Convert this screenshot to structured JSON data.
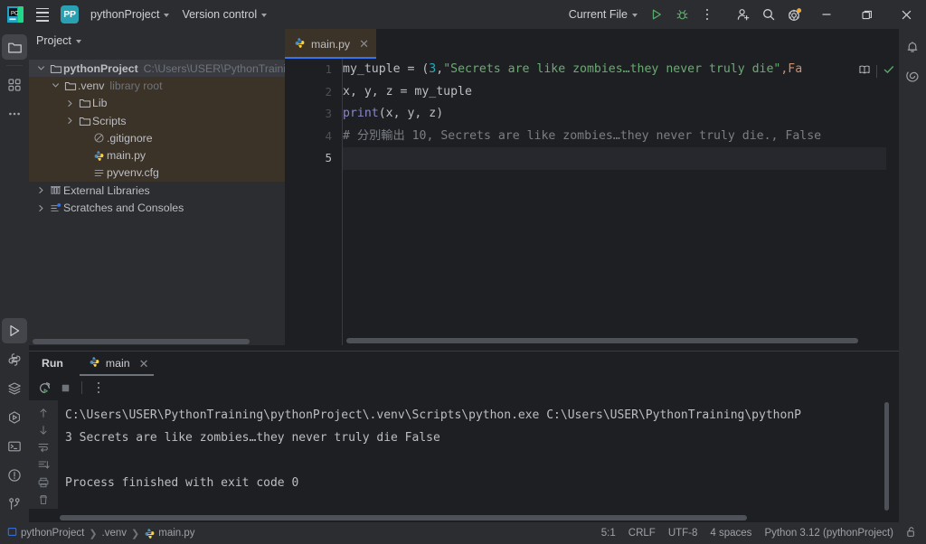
{
  "titlebar": {
    "ide_icon": "pycharm-logo-icon",
    "menu_icon": "main-menu-hamburger-icon",
    "project_badge": "PP",
    "project_name": "pythonProject",
    "version_control": "Version control",
    "run_config": "Current File",
    "run_icon": "run-triangle-icon",
    "debug_icon": "debug-bug-icon",
    "more_icon": "more-vertical-icon",
    "account_icon": "add-user-icon",
    "search_icon": "search-magnifier-icon",
    "settings_icon": "gear-icon",
    "minimize_icon": "window-minimize-icon",
    "maximize_icon": "window-maximize-icon",
    "close_icon": "window-close-icon"
  },
  "left_activity_bar": {
    "items": [
      {
        "name": "project-tool-button",
        "icon": "folder-icon",
        "selected": true
      },
      {
        "name": "structure-tool-button",
        "icon": "structure-squares-icon",
        "selected": false
      },
      {
        "name": "more-tool-windows-button",
        "icon": "more-horizontal-icon",
        "selected": false
      }
    ],
    "bottom_items": [
      {
        "name": "run-tool-button",
        "icon": "run-triangle-icon",
        "selected": true
      },
      {
        "name": "python-packages-button",
        "icon": "python-icon",
        "selected": false
      },
      {
        "name": "python-console-button",
        "icon": "layers-icon",
        "selected": false
      },
      {
        "name": "services-button",
        "icon": "services-hexagon-play-icon",
        "selected": false
      },
      {
        "name": "terminal-button",
        "icon": "terminal-icon",
        "selected": false
      },
      {
        "name": "problems-button",
        "icon": "warning-circle-icon",
        "selected": false
      },
      {
        "name": "version-control-button",
        "icon": "git-branch-icon",
        "selected": false
      }
    ]
  },
  "right_activity_bar": {
    "items": [
      {
        "name": "notifications-button",
        "icon": "bell-icon"
      },
      {
        "name": "ai-assistant-button",
        "icon": "spiral-ai-icon"
      }
    ]
  },
  "sidebar": {
    "header": "Project",
    "header_chevron": "chevron-down-icon",
    "tree": [
      {
        "name": "tree-node-pythonproject",
        "label": "pythonProject",
        "sub": "C:\\Users\\USER\\PythonTraining\\python",
        "indent": 0,
        "twisty": "expanded",
        "icon": "folder-icon",
        "bold": true,
        "selected": true,
        "tint": false
      },
      {
        "name": "tree-node-venv",
        "label": ".venv",
        "sub": "library root",
        "indent": 1,
        "twisty": "expanded",
        "icon": "folder-icon",
        "bold": false,
        "selected": false,
        "tint": true
      },
      {
        "name": "tree-node-lib",
        "label": "Lib",
        "sub": "",
        "indent": 2,
        "twisty": "collapsed",
        "icon": "folder-icon",
        "bold": false,
        "selected": false,
        "tint": true
      },
      {
        "name": "tree-node-scripts",
        "label": "Scripts",
        "sub": "",
        "indent": 2,
        "twisty": "collapsed",
        "icon": "folder-icon",
        "bold": false,
        "selected": false,
        "tint": true
      },
      {
        "name": "tree-node-gitignore",
        "label": ".gitignore",
        "sub": "",
        "indent": 3,
        "twisty": "none",
        "icon": "gitignore-circle-slash-icon",
        "bold": false,
        "selected": false,
        "tint": true
      },
      {
        "name": "tree-node-mainpy",
        "label": "main.py",
        "sub": "",
        "indent": 3,
        "twisty": "none",
        "icon": "python-icon",
        "bold": false,
        "selected": false,
        "tint": true
      },
      {
        "name": "tree-node-pyvenvcfg",
        "label": "pyvenv.cfg",
        "sub": "",
        "indent": 3,
        "twisty": "none",
        "icon": "config-lines-icon",
        "bold": false,
        "selected": false,
        "tint": true
      },
      {
        "name": "tree-node-external-libraries",
        "label": "External Libraries",
        "sub": "",
        "indent": 0,
        "twisty": "collapsed",
        "icon": "library-columns-icon",
        "bold": false,
        "selected": false,
        "tint": false
      },
      {
        "name": "tree-node-scratches",
        "label": "Scratches and Consoles",
        "sub": "",
        "indent": 0,
        "twisty": "collapsed",
        "icon": "scratches-icon",
        "bold": false,
        "selected": false,
        "tint": false
      }
    ]
  },
  "editor": {
    "tab": {
      "label": "main.py",
      "icon": "python-icon",
      "close_icon": "close-icon"
    },
    "gutter_lines": [
      "1",
      "2",
      "3",
      "4",
      "5"
    ],
    "current_line": 5,
    "lines": [
      {
        "n": 1,
        "tokens": [
          {
            "t": "my_tuple = (",
            "c": "plain"
          },
          {
            "t": "3",
            "c": "num"
          },
          {
            "t": ",",
            "c": "plain"
          },
          {
            "t": "\"Secrets are like zombies…they never truly die\"",
            "c": "str"
          },
          {
            "t": ",Fa",
            "c": "kw"
          }
        ]
      },
      {
        "n": 2,
        "tokens": [
          {
            "t": "x, y, z = my_tuple",
            "c": "plain"
          }
        ]
      },
      {
        "n": 3,
        "tokens": [
          {
            "t": "print",
            "c": "fn"
          },
          {
            "t": "(x, y, z)",
            "c": "plain"
          }
        ]
      },
      {
        "n": 4,
        "tokens": [
          {
            "t": "# 分別輸出 10, Secrets are like zombies…they never truly die., False",
            "c": "cm"
          }
        ]
      },
      {
        "n": 5,
        "tokens": [
          {
            "t": "",
            "c": "plain"
          }
        ]
      }
    ],
    "hint_icons": {
      "reader_mode": "book-open-icon",
      "inspection_ok": "checkmark-icon",
      "ai_assistant": "spiral-ai-icon"
    }
  },
  "run_window": {
    "title": "Run",
    "tab": {
      "label": "main",
      "icon": "python-icon",
      "close_icon": "close-icon"
    },
    "toolbar": [
      {
        "name": "rerun-button",
        "icon": "rerun-circular-arrow-icon"
      },
      {
        "name": "stop-button",
        "icon": "stop-square-icon"
      },
      {
        "name": "run-more-button",
        "icon": "more-vertical-icon"
      }
    ],
    "gutter": [
      {
        "name": "scroll-up-button",
        "icon": "arrow-up-icon"
      },
      {
        "name": "scroll-down-button",
        "icon": "arrow-down-icon"
      },
      {
        "name": "soft-wrap-button",
        "icon": "soft-wrap-icon"
      },
      {
        "name": "scroll-to-end-button",
        "icon": "scroll-to-end-icon"
      },
      {
        "name": "print-button",
        "icon": "printer-icon"
      },
      {
        "name": "clear-all-button",
        "icon": "trash-icon"
      }
    ],
    "console_lines": [
      "C:\\Users\\USER\\PythonTraining\\pythonProject\\.venv\\Scripts\\python.exe C:\\Users\\USER\\PythonTraining\\pythonP",
      "3 Secrets are like zombies…they never truly die False",
      "",
      "Process finished with exit code 0"
    ]
  },
  "statusbar": {
    "breadcrumbs": [
      {
        "name": "breadcrumb-project",
        "label": "pythonProject",
        "icon": "project-icon"
      },
      {
        "name": "breadcrumb-venv",
        "label": ".venv",
        "icon": "none"
      },
      {
        "name": "breadcrumb-file",
        "label": "main.py",
        "icon": "python-icon"
      }
    ],
    "caret_position": "5:1",
    "line_separator": "CRLF",
    "encoding": "UTF-8",
    "indent": "4 spaces",
    "interpreter": "Python 3.12 (pythonProject)",
    "readonly_icon": "lock-open-icon"
  },
  "colors": {
    "titlebar_bg": "#2b2d30",
    "editor_bg": "#1e1f22",
    "accent_blue": "#3574f0",
    "badge_teal": "#2aa1b3",
    "string_green": "#6aab73",
    "number_teal": "#2aacb8",
    "function_violet": "#8888c6",
    "keyword_orange": "#cf8e6d",
    "comment_gray": "#7a7e85",
    "venv_tint": "#3b3328",
    "selection_gray": "#393b40",
    "run_green": "#59a869"
  }
}
